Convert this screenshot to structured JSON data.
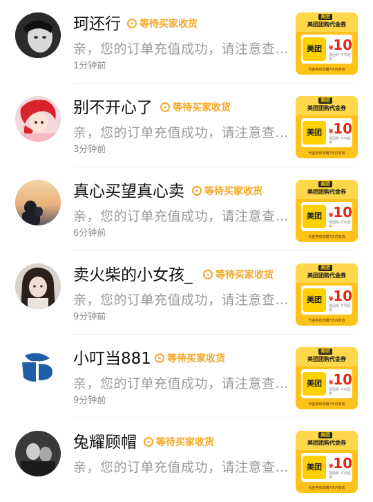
{
  "conversations": [
    {
      "name": "珂还行",
      "status": "等待买家收货",
      "message": "亲，您的订单充值成功，请注意查…",
      "time": "1分钟前",
      "avatar": "avatar-bw-portrait"
    },
    {
      "name": "别不开心了",
      "status": "等待买家收货",
      "message": "亲，您的订单充值成功，请注意查…",
      "time": "3分钟前",
      "avatar": "avatar-red-hair-cartoon"
    },
    {
      "name": "真心买望真心卖",
      "status": "等待买家收货",
      "message": "亲，您的订单充值成功，请注意查…",
      "time": "6分钟前",
      "avatar": "avatar-sunset-couple"
    },
    {
      "name": "卖火柴的小女孩_",
      "status": "等待买家收货",
      "message": "亲，您的订单充值成功，请注意查…",
      "time": "9分钟前",
      "avatar": "avatar-girl-selfie"
    },
    {
      "name": "小叮当881",
      "status": "等待买家收货",
      "message": "亲，您的订单充值成功，请注意查…",
      "time": "9分钟前",
      "avatar": "avatar-redoux-logo"
    },
    {
      "name": "兔耀顾帽",
      "status": "等待买家收货",
      "message": "亲，您的订单充值成功，请注意查…",
      "time": "",
      "avatar": "avatar-bw-group"
    }
  ],
  "voucher": {
    "brand": "美团",
    "title": "美团团购代金券",
    "logo": "美团",
    "amount": "10",
    "currency": "¥",
    "note": "限团购 不可退券",
    "footer": "代金券有效期7天内有效"
  },
  "colors": {
    "status": "#f5a623",
    "voucher_bg": "#ffc21a",
    "amount": "#e8260f"
  },
  "icons": {
    "status": "clock-icon"
  }
}
